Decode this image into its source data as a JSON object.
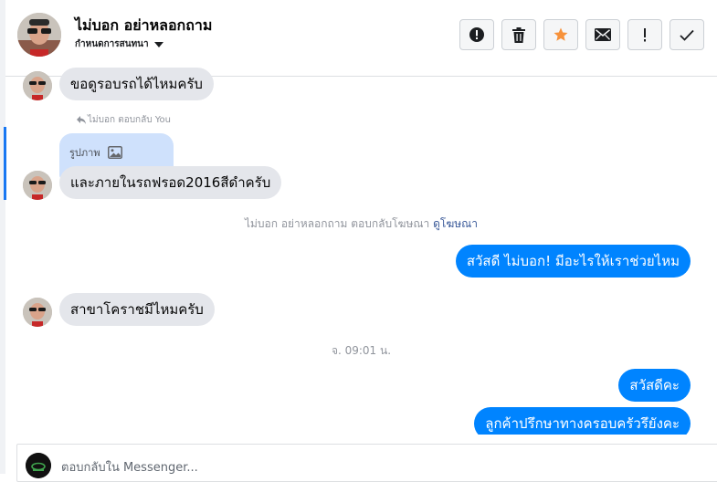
{
  "header": {
    "contact_name": "ไม่บอก อย่าหลอกถาม",
    "stage_label": "กำหนดการสนทนา",
    "actions": [
      {
        "icon": "alert-circle-icon"
      },
      {
        "icon": "trash-icon"
      },
      {
        "icon": "star-icon"
      },
      {
        "icon": "envelope-icon"
      },
      {
        "icon": "exclamation-icon"
      },
      {
        "icon": "checkmark-icon"
      }
    ]
  },
  "colors": {
    "accent": "#0084ff",
    "star": "#f7923b",
    "incoming_bubble": "#e4e6eb",
    "quoted_bubble": "#cfe1fc"
  },
  "messages": {
    "m1": "ขอดูรอบรถได้ไหมครับ",
    "reply_label": "ไม่บอก ตอบกลับ You",
    "quoted_text": "รูปภาพ",
    "m2": "และภายในรถฟรอด2016สีดำครับ",
    "ad_reply_note": "ไม่บอก อย่าหลอกถาม ตอบกลับโฆษณา",
    "ad_link": "ดูโฆษณา",
    "out1": "สวัสดี ไม่บอก! มีอะไรให้เราช่วยไหม",
    "m3": "สาขาโคราชมีไหมครับ",
    "timestamp": "จ. 09:01 น.",
    "out2": "สวัสดีคะ",
    "out3": "ลูกค้าปรึกษาทางครอบครัวรึยังคะ"
  },
  "composer": {
    "placeholder": "ตอบกลับใน Messenger..."
  }
}
